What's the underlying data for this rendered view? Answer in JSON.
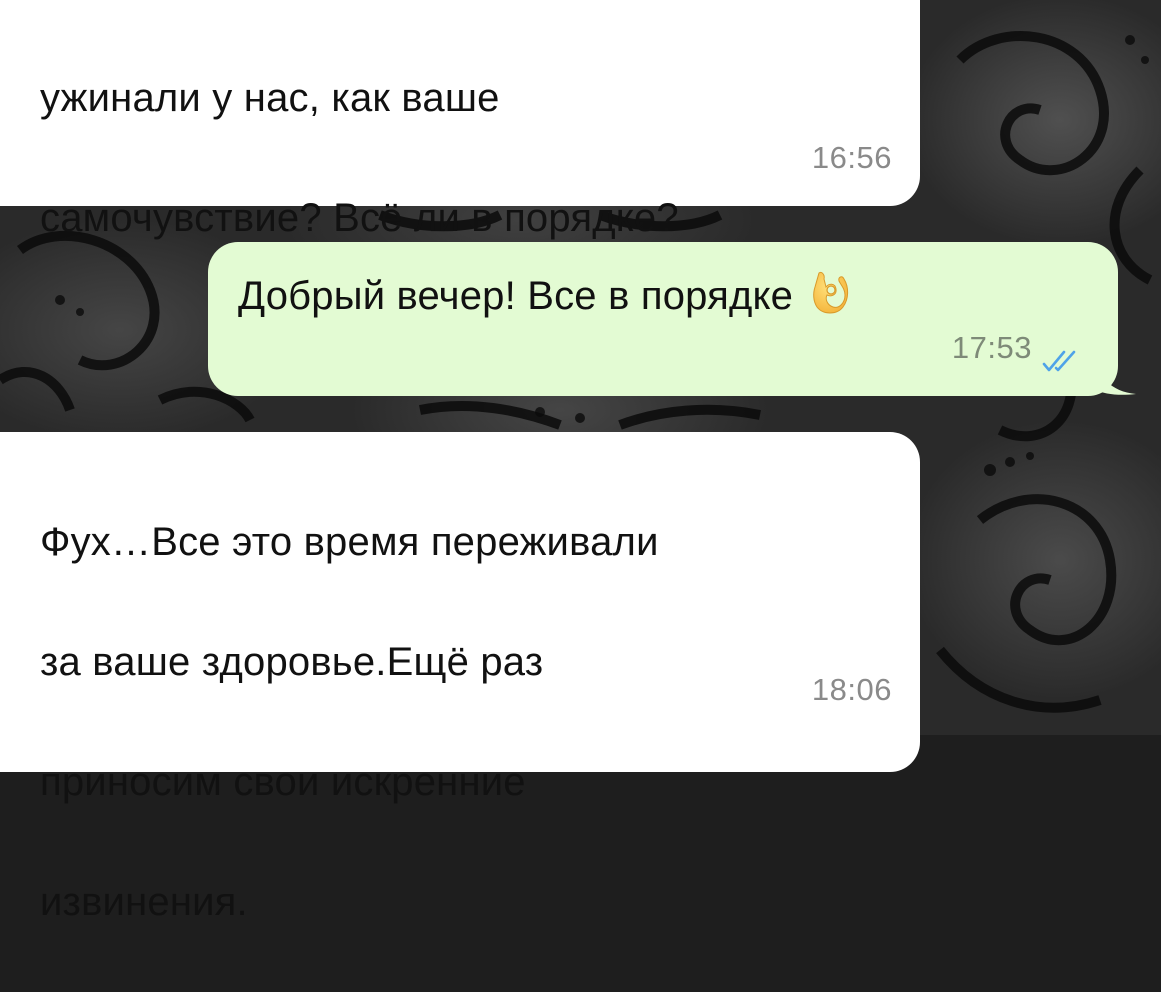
{
  "messages": [
    {
      "direction": "incoming",
      "lines": [
        "ужинали у нас, как ваше",
        "самочувствие? Всё ли в порядке?"
      ],
      "time": "16:56"
    },
    {
      "direction": "outgoing",
      "text": "Добрый вечер! Все в порядке",
      "emoji": "ok-hand-emoji",
      "time": "17:53",
      "status": "read",
      "status_icon": "double-check-icon"
    },
    {
      "direction": "incoming",
      "lines": [
        "Фух…Все это время переживали",
        "за ваше здоровье.Ещё раз",
        "приносим свои искренние",
        "извинения."
      ],
      "time": "18:06"
    }
  ],
  "colors": {
    "incoming_bubble": "#ffffff",
    "outgoing_bubble": "#e3fbd3",
    "read_ticks": "#4fa3e8",
    "background": "#2a2a2a"
  }
}
